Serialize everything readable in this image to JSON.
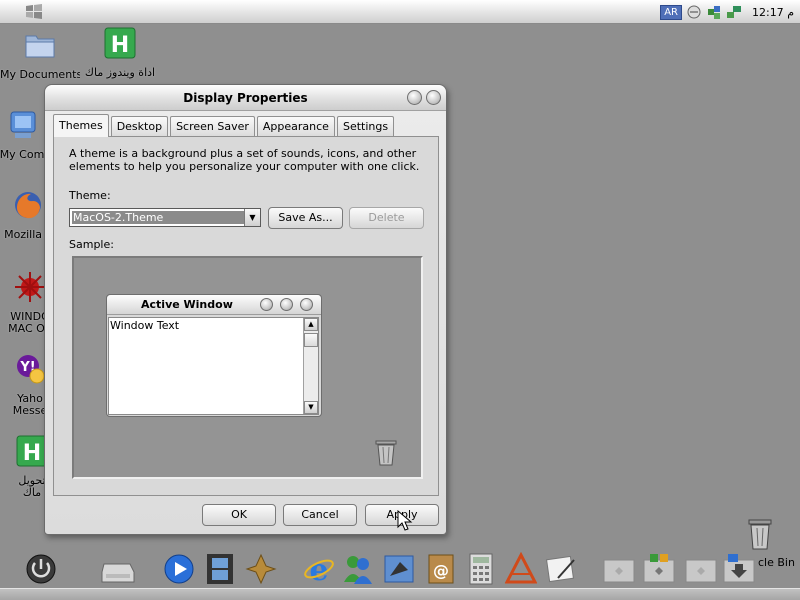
{
  "menubar": {
    "language_badge": "AR",
    "clock": "12:17 م"
  },
  "desktop_icons": [
    {
      "label": "My Documents",
      "icon": "folder-icon"
    },
    {
      "label": "اداة ويندوز ماك",
      "icon": "h-app-icon"
    },
    {
      "label": "My Com",
      "icon": "computer-icon"
    },
    {
      "label": "Mozilla F",
      "icon": "firefox-icon"
    },
    {
      "label": "WINDO",
      "label2": "MAC OS",
      "icon": "virus-icon"
    },
    {
      "label": "Yaho",
      "label2": "Messe",
      "icon": "yahoo-icon"
    },
    {
      "label": "تحويل",
      "label2": "ماك",
      "icon": "h-app-icon"
    }
  ],
  "dialog": {
    "title": "Display Properties",
    "tabs": [
      "Themes",
      "Desktop",
      "Screen Saver",
      "Appearance",
      "Settings"
    ],
    "active_tab": "Themes",
    "description": "A theme is a background plus a set of sounds, icons, and other elements to help you personalize your computer with one click.",
    "theme_label": "Theme:",
    "theme_value": "MacOS-2.Theme",
    "save_as_label": "Save As...",
    "delete_label": "Delete",
    "sample_label": "Sample:",
    "sample_window": {
      "title": "Active Window",
      "text": "Window Text"
    },
    "ok_label": "OK",
    "cancel_label": "Cancel",
    "apply_label": "Apply"
  },
  "recycle_bin_label": "cle Bin",
  "dock_icons": [
    "power-icon",
    "hard-drive-icon",
    "quicktime-icon",
    "film-icon",
    "spotlight-icon",
    "internet-explorer-icon",
    "messenger-icon",
    "mail-icon",
    "address-book-icon",
    "calculator-icon",
    "textedit-icon",
    "preview-icon",
    "folder-icon",
    "apps-folder-icon",
    "downloads-icon"
  ]
}
